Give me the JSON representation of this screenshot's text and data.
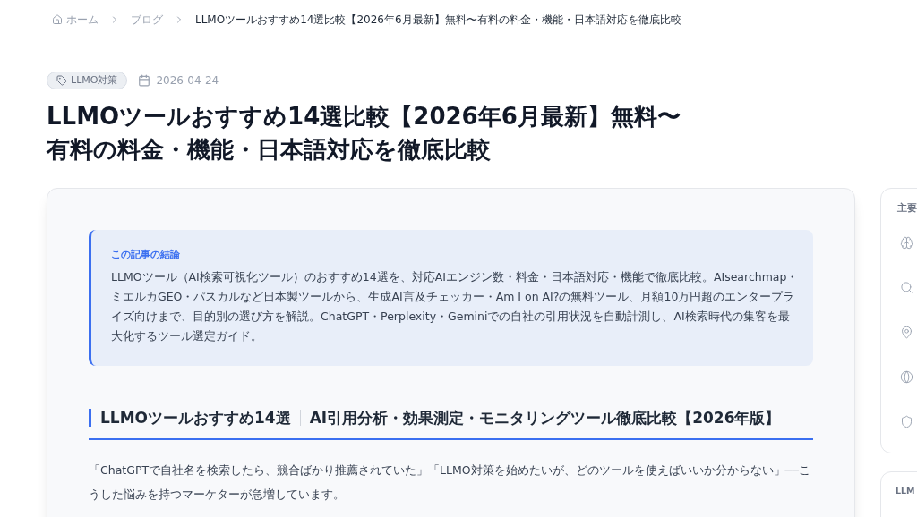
{
  "breadcrumb": [
    {
      "label": "ホーム",
      "kind": "home"
    },
    {
      "label": "ブログ",
      "kind": "link"
    },
    {
      "label": "LLMOツールおすすめ14選比較【2026年6月最新】無料〜有料の料金・機能・日本語対応を徹底比較",
      "kind": "current"
    }
  ],
  "tag": "LLMO対策",
  "date": "2026-04-24",
  "title_lines": [
    "LLMOツールおすすめ14選比較【2026年6月最新】無料〜",
    "有料の料金・機能・日本語対応を徹底比較"
  ],
  "summary": {
    "label": "この記事の結論",
    "text": "LLMOツール（AI検索可視化ツール）のおすすめ14選を、対応AIエンジン数・料金・日本語対応・機能で徹底比較。AIsearchmap・ミエルカGEO・パスカルなど日本製ツールから、生成AI言及チェッカー・Am I on AI?の無料ツール、月額10万円超のエンタープライズ向けまで、目的別の選び方を解説。ChatGPT・Perplexity・Geminiでの自社の引用状況を自動計測し、AI検索時代の集客を最大化するツール選定ガイド。"
  },
  "section_heading": {
    "main": "LLMOツールおすすめ14選",
    "sub": "AI引用分析・効果測定・モニタリングツール徹底比較【2026年版】"
  },
  "intro": "「ChatGPTで自社名を検索したら、競合ばかり推薦されていた」「LLMO対策を始めたいが、どのツールを使えばいいか分からない」──こうした悩みを持つマーケターが急増しています。",
  "sidebar": {
    "title": "主要",
    "items": [
      {
        "kind": "brain"
      },
      {
        "kind": "search"
      },
      {
        "kind": "pin"
      },
      {
        "kind": "globe"
      },
      {
        "kind": "shield"
      }
    ],
    "second_title": "LLM"
  }
}
